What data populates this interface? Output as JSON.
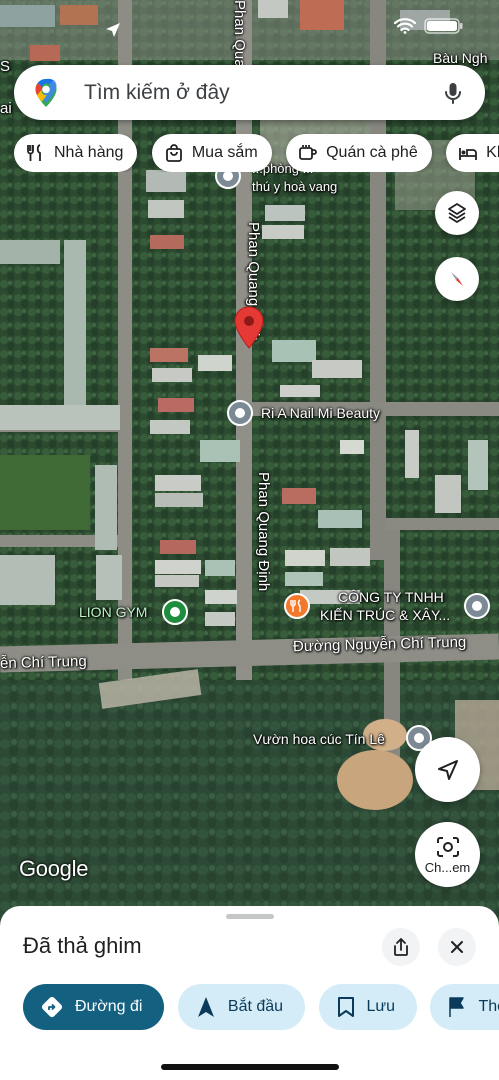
{
  "status_bar": {
    "icons": [
      "location-arrow-icon",
      "wifi-icon",
      "battery-icon"
    ]
  },
  "search": {
    "placeholder": "Tìm kiếm ở đây",
    "logo_icon": "google-maps-pin-logo",
    "mic_icon": "microphone-icon"
  },
  "chips": [
    {
      "label": "Nhà hàng",
      "icon": "fork-knife-icon"
    },
    {
      "label": "Mua sắm",
      "icon": "shopping-bag-icon"
    },
    {
      "label": "Quán cà phê",
      "icon": "coffee-cup-icon"
    },
    {
      "label": "Khá",
      "icon": "bed-icon"
    }
  ],
  "map": {
    "road_labels": {
      "top_right": "Bàu Ngh",
      "left_top": "S",
      "left_mid": "ai",
      "phan_top": "Phan Qua",
      "phan_upper": "Phan Quang Định",
      "phan_lower": "Phan Quang Định",
      "nguyen_left": "ễn Chí Trung",
      "nguyen_right": "Đường Nguyễn Chí Trung"
    },
    "pois": {
      "vet_line1": "...phòng ...",
      "vet_line2": "thú y hoà vang",
      "nail": "Ri A Nail Mi Beauty",
      "gym": "LION GYM",
      "company_line1": "CÔNG TY TNHH",
      "company_line2": "KIẾN TRÚC & XÂY...",
      "flower": "Vườn hoa cúc Tín Lê"
    },
    "dropped_pin_color": "#e53935",
    "google_logo": "Google",
    "layers_icon": "layers-icon",
    "compass_icon": "compass-icon",
    "my_location_icon": "navigation-arrow-icon",
    "lens_label": "Ch...em",
    "lens_icon": "camera-lens-icon"
  },
  "sheet": {
    "title": "Đã thả ghim",
    "share_icon": "share-icon",
    "close_icon": "close-icon",
    "actions": [
      {
        "label": "Đường đi",
        "icon": "directions-icon",
        "primary": true
      },
      {
        "label": "Bắt đầu",
        "icon": "navigation-icon",
        "primary": false
      },
      {
        "label": "Lưu",
        "icon": "bookmark-icon",
        "primary": false
      },
      {
        "label": "Thê",
        "icon": "flag-icon",
        "primary": false
      }
    ]
  },
  "colors": {
    "primary_action": "#136080",
    "secondary_action": "#d3ecf7",
    "pin_red": "#e53935",
    "poi_gray": "#7c8a96",
    "poi_green": "#1e8e3e",
    "poi_orange": "#f2782c"
  }
}
